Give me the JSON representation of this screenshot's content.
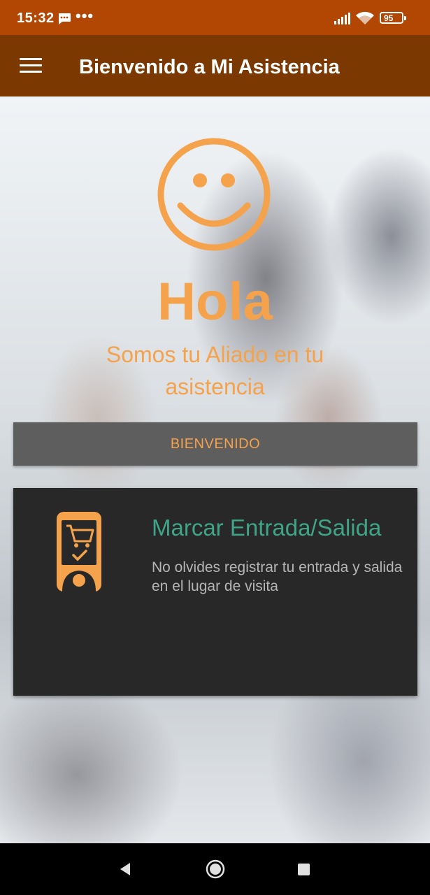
{
  "status_bar": {
    "time": "15:32",
    "battery": "95",
    "icons": [
      "message-icon",
      "more-dots-icon",
      "signal-icon",
      "wifi-icon",
      "battery-icon"
    ]
  },
  "app_bar": {
    "title": "Bienvenido a Mi Asistencia",
    "menu_icon": "hamburger-menu-icon"
  },
  "hero": {
    "icon": "smiley-icon",
    "greeting": "Hola",
    "tagline": "Somos tu Aliado en tu asistencia"
  },
  "welcome_button": {
    "label": "BIENVENIDO"
  },
  "feature_card": {
    "icon": "mobile-cart-icon",
    "title": "Marcar Entrada/Salida",
    "description": "No olvides registrar tu entrada y salida en el lugar de visita"
  },
  "nav_bar": {
    "icons": [
      "back-icon",
      "home-icon",
      "recents-icon"
    ]
  },
  "colors": {
    "status_bar": "#b14703",
    "app_bar": "#7b3800",
    "accent_orange": "#f5a24c",
    "card_title": "#3fa586",
    "card_bg": "#282828",
    "button_bg": "#5e5e5e"
  }
}
